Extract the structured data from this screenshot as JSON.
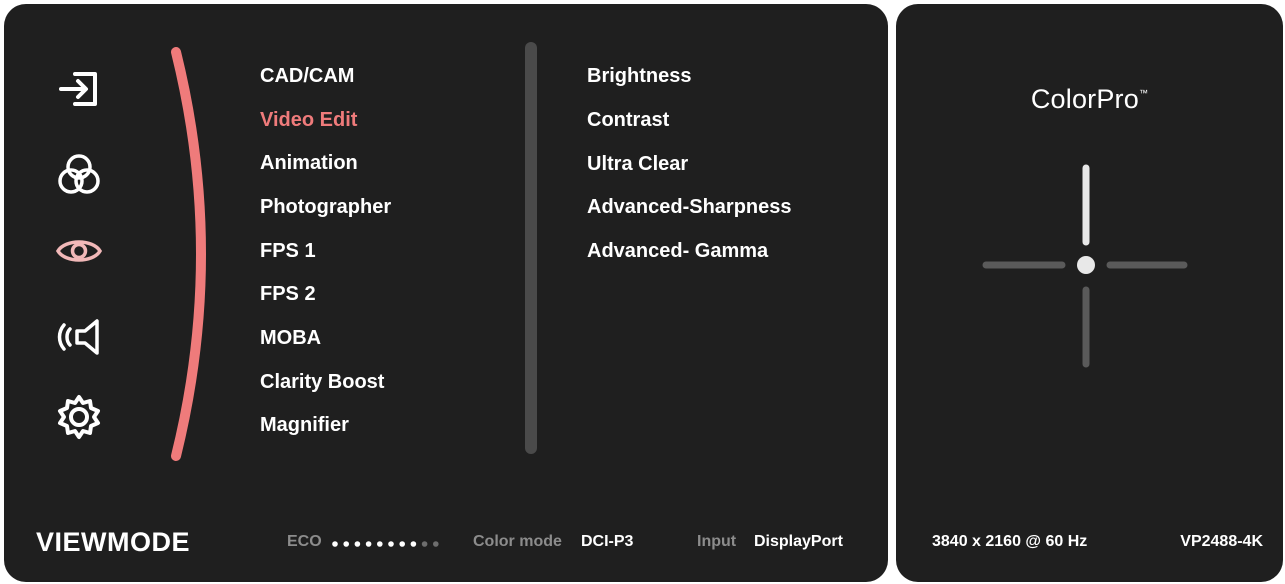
{
  "sidebar": {
    "icons": [
      {
        "name": "input-icon"
      },
      {
        "name": "color-adjust-icon"
      },
      {
        "name": "viewmode-eye-icon",
        "active": true
      },
      {
        "name": "audio-speaker-icon"
      },
      {
        "name": "setup-gear-icon"
      }
    ]
  },
  "viewmode_menu": {
    "items": [
      {
        "label": "CAD/CAM"
      },
      {
        "label": "Video Edit",
        "selected": true
      },
      {
        "label": "Animation"
      },
      {
        "label": "Photographer"
      },
      {
        "label": "FPS 1"
      },
      {
        "label": "FPS 2"
      },
      {
        "label": "MOBA"
      },
      {
        "label": "Clarity Boost"
      },
      {
        "label": "Magnifier"
      }
    ]
  },
  "submenu": {
    "items": [
      {
        "label": "Brightness"
      },
      {
        "label": "Contrast"
      },
      {
        "label": "Ultra Clear"
      },
      {
        "label": "Advanced-Sharpness"
      },
      {
        "label": "Advanced- Gamma"
      }
    ]
  },
  "footer": {
    "title": "VIEWMODE",
    "eco_label": "ECO",
    "eco_level": 0.8,
    "color_mode_label": "Color mode",
    "color_mode_value": "DCI-P3",
    "input_label": "Input",
    "input_value": "DisplayPort"
  },
  "info_panel": {
    "brand": "ColorPro",
    "brand_mark": "™",
    "resolution": "3840 x 2160 @ 60 Hz",
    "model": "VP2488-4K"
  },
  "colors": {
    "accent": "#ef7b7b",
    "panel_bg": "#1f1f1f",
    "muted_text": "#8c8c8c"
  }
}
